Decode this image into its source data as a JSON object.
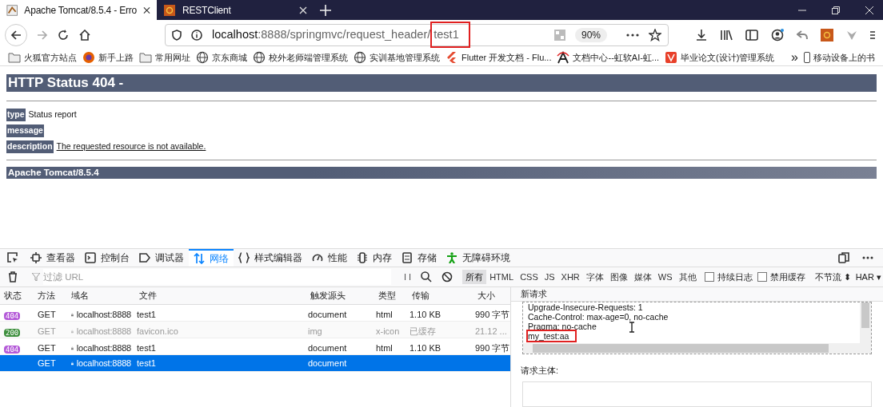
{
  "browser": {
    "tabs": [
      {
        "title": "Apache Tomcat/8.5.4 - Erro",
        "selected": true
      },
      {
        "title": "RESTClient",
        "selected": false
      }
    ],
    "url": {
      "host": "localhost",
      "path": ":8888/springmvc/request_header/",
      "last": "test1",
      "highlighted": true
    },
    "zoom": "90%",
    "bookmarks": [
      {
        "label": "火狐官方站点",
        "kind": "folder"
      },
      {
        "label": "新手上路",
        "kind": "firefox"
      },
      {
        "label": "常用网址",
        "kind": "folder"
      },
      {
        "label": "京东商城",
        "kind": "globe"
      },
      {
        "label": "校外老师端管理系统",
        "kind": "globe"
      },
      {
        "label": "实训基地管理系统",
        "kind": "globe"
      },
      {
        "label": "Flutter 开发文档 - Flu...",
        "kind": "flutter"
      },
      {
        "label": "文档中心--虹软AI-虹...",
        "kind": "arc"
      },
      {
        "label": "毕业论文(设计)管理系统",
        "kind": "shield"
      }
    ],
    "more": "»",
    "mobile_bookmarks": "移动设备上的书"
  },
  "page": {
    "title": "HTTP Status 404 -",
    "rows": [
      {
        "label": "type",
        "text": "Status report"
      },
      {
        "label": "message"
      },
      {
        "label": "description",
        "text": "The requested resource is not available."
      }
    ],
    "footer": "Apache Tomcat/8.5.4"
  },
  "devtools": {
    "tabs": [
      {
        "label": "查看器",
        "selected": false
      },
      {
        "label": "控制台",
        "selected": false
      },
      {
        "label": "调试器",
        "selected": false
      },
      {
        "label": "网络",
        "selected": true
      },
      {
        "label": "样式编辑器",
        "selected": false
      },
      {
        "label": "性能",
        "selected": false
      },
      {
        "label": "内存",
        "selected": false
      },
      {
        "label": "存储",
        "selected": false
      },
      {
        "label": "无障碍环境",
        "selected": false
      }
    ],
    "filter_placeholder": "过滤 URL",
    "pause": "I I",
    "types": [
      {
        "label": "所有",
        "selected": true
      },
      {
        "label": "HTML",
        "selected": false
      },
      {
        "label": "CSS",
        "selected": false
      },
      {
        "label": "JS",
        "selected": false
      },
      {
        "label": "XHR",
        "selected": false
      },
      {
        "label": "字体",
        "selected": false
      },
      {
        "label": "图像",
        "selected": false
      },
      {
        "label": "媒体",
        "selected": false
      },
      {
        "label": "WS",
        "selected": false
      },
      {
        "label": "其他",
        "selected": false
      }
    ],
    "options": [
      {
        "label": "持续日志",
        "checked": false
      },
      {
        "label": "禁用缓存",
        "checked": false
      }
    ],
    "throttle": "不节流 ⬍",
    "har": "HAR ▾",
    "columns": [
      "状态",
      "方法",
      "域名",
      "文件",
      "触发源头",
      "类型",
      "传输",
      "大小"
    ],
    "rows": [
      {
        "status": "404",
        "color": "#b45ad8",
        "method": "GET",
        "domain": "localhost:8888",
        "file": "test1",
        "cause": "document",
        "type": "html",
        "transfer": "1.10 KB",
        "size": "990 字节",
        "selected": false,
        "cached": false
      },
      {
        "status": "200",
        "color": "#3d8f3d",
        "method": "GET",
        "domain": "localhost:8888",
        "file": "favicon.ico",
        "cause": "img",
        "type": "x-icon",
        "transfer": "已缓存",
        "size": "21.12 ...",
        "selected": false,
        "cached": true
      },
      {
        "status": "404",
        "color": "#b45ad8",
        "method": "GET",
        "domain": "localhost:8888",
        "file": "test1",
        "cause": "document",
        "type": "html",
        "transfer": "1.10 KB",
        "size": "990 字节",
        "selected": false,
        "cached": false
      },
      {
        "method": "GET",
        "domain": "localhost:8888",
        "file": "test1",
        "cause": "document",
        "selected": true,
        "cached": false
      }
    ],
    "panel": {
      "title": "新请求",
      "headers": [
        {
          "text": "Upgrade-Insecure-Requests: 1",
          "highlighted": false
        },
        {
          "text": "Cache-Control: max-age=0, no-cache",
          "highlighted": false
        },
        {
          "text": "Pragma: no-cache",
          "highlighted": false
        },
        {
          "text": "my_test:aa",
          "highlighted": true
        }
      ],
      "body_label": "请求主体:"
    }
  }
}
